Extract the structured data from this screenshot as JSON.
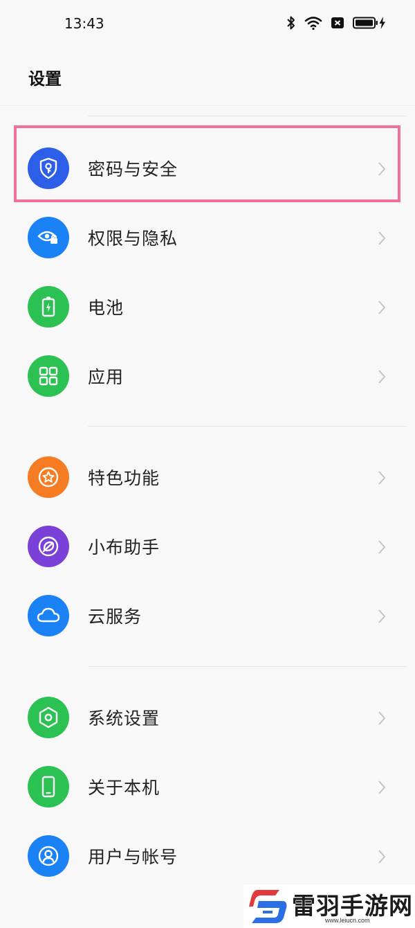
{
  "status_bar": {
    "time": "13:43",
    "icons": [
      "bluetooth-icon",
      "wifi-icon",
      "sim-blocked-icon",
      "battery-charging-icon"
    ]
  },
  "page": {
    "title": "设置"
  },
  "highlight_color": "#f0729a",
  "settings": [
    {
      "label": "密码与安全",
      "icon": "shield-key-icon",
      "color": "#2c5ee8"
    },
    {
      "label": "权限与隐私",
      "icon": "eye-lock-icon",
      "color": "#1a82f5"
    },
    {
      "label": "电池",
      "icon": "battery-icon",
      "color": "#2bc253"
    },
    {
      "label": "应用",
      "icon": "apps-grid-icon",
      "color": "#2bc253"
    },
    {
      "label": "特色功能",
      "icon": "star-icon",
      "color": "#f57c22"
    },
    {
      "label": "小布助手",
      "icon": "assistant-icon",
      "color": "#7a40d8"
    },
    {
      "label": "云服务",
      "icon": "cloud-icon",
      "color": "#1a82f5"
    },
    {
      "label": "系统设置",
      "icon": "hexagon-gear-icon",
      "color": "#2bc253"
    },
    {
      "label": "关于本机",
      "icon": "phone-icon",
      "color": "#2bc253"
    },
    {
      "label": "用户与帐号",
      "icon": "user-icon",
      "color": "#1a82f5"
    }
  ],
  "watermark": {
    "text": "雷羽手游网",
    "url": "www.leiucn.com"
  }
}
